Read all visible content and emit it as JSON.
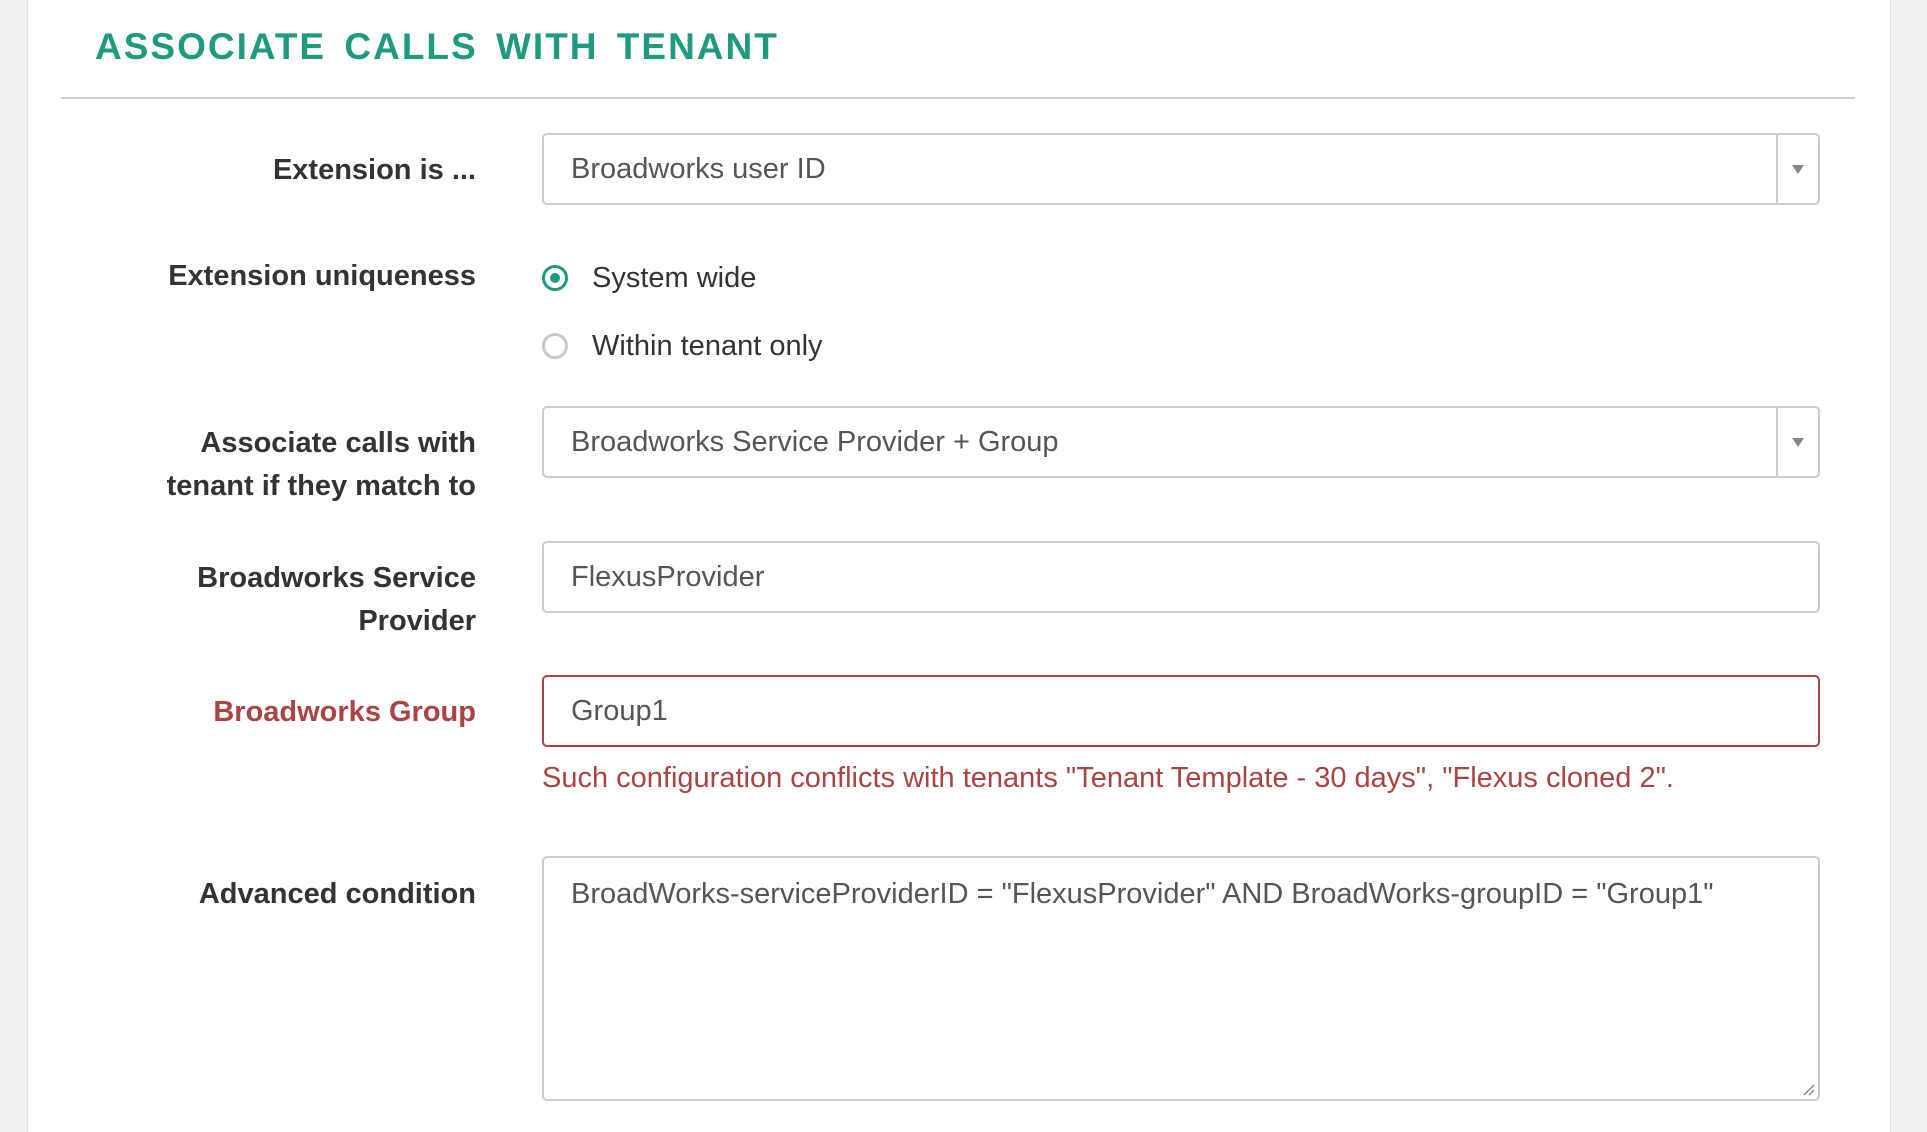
{
  "section": {
    "title": "ASSOCIATE CALLS WITH TENANT"
  },
  "extension_is": {
    "label": "Extension is ...",
    "selected": "Broadworks user ID"
  },
  "extension_uniqueness": {
    "label": "Extension uniqueness",
    "options": [
      {
        "label": "System wide",
        "checked": true
      },
      {
        "label": "Within tenant only",
        "checked": false
      }
    ]
  },
  "associate_match": {
    "label_line1": "Associate calls with",
    "label_line2": "tenant if they match to",
    "selected": "Broadworks Service Provider + Group"
  },
  "service_provider": {
    "label_line1": "Broadworks Service",
    "label_line2": "Provider",
    "value": "FlexusProvider"
  },
  "group": {
    "label": "Broadworks Group",
    "value": "Group1",
    "error": "Such configuration conflicts with tenants \"Tenant Template - 30 days\", \"Flexus cloned 2\"."
  },
  "advanced_condition": {
    "label": "Advanced condition",
    "value": "BroadWorks-serviceProviderID = \"FlexusProvider\" AND BroadWorks-groupID = \"Group1\""
  },
  "colors": {
    "accent": "#1d9a80",
    "error": "#a94442"
  }
}
